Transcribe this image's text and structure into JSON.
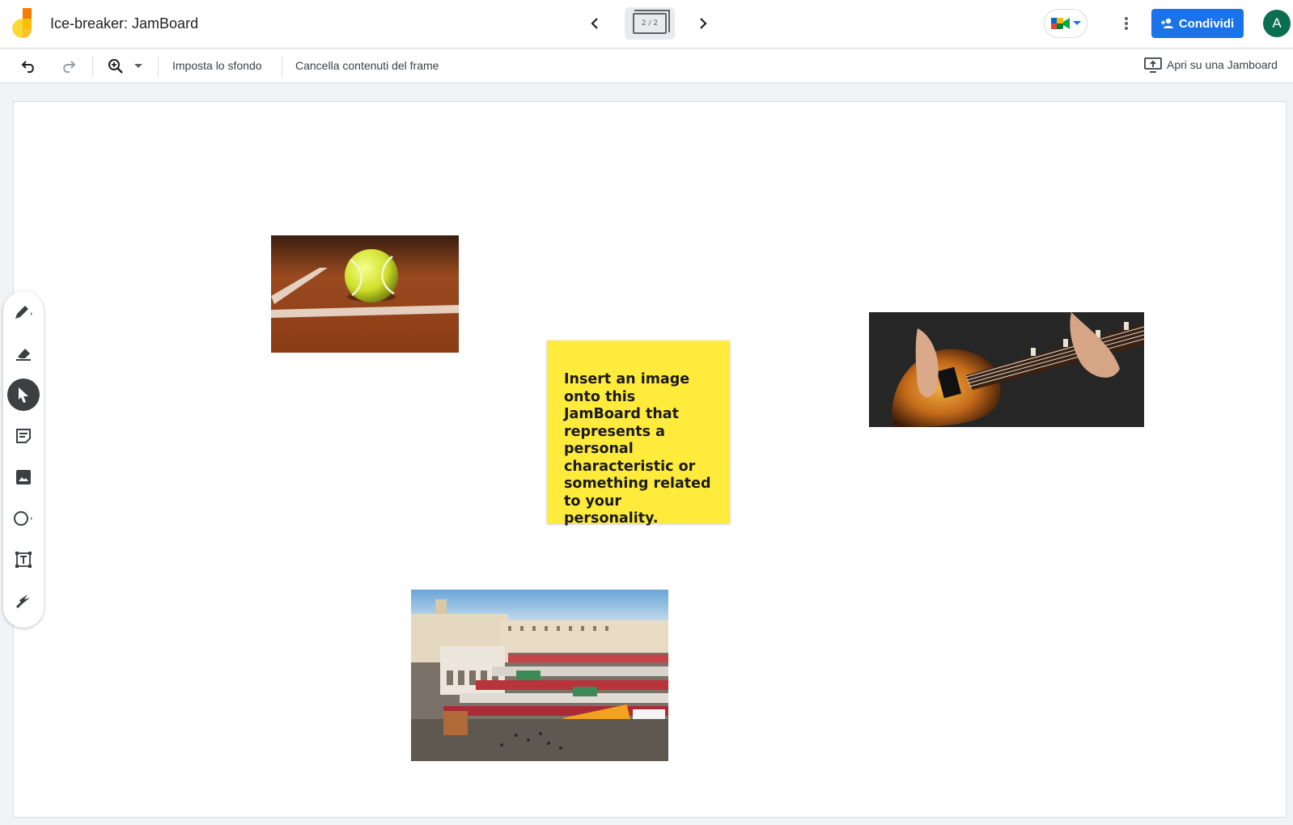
{
  "app": {
    "title": "Ice-breaker: JamBoard",
    "frame_counter": "2 / 2"
  },
  "header": {
    "share_label": "Condividi",
    "avatar_initial": "A"
  },
  "toolbar": {
    "set_background_label": "Imposta lo sfondo",
    "clear_frame_label": "Cancella contenuti del frame",
    "open_on_jamboard_label": "Apri su una Jamboard"
  },
  "board": {
    "sticky_note": {
      "text": "Insert an image onto this JamBoard that represents a personal characteristic or something related to your personality.",
      "color": "#ffeb3b"
    },
    "images": [
      "tennis ball on clay court",
      "person playing electric guitar",
      "aerial view of city market square"
    ]
  },
  "tools": [
    "pen-icon",
    "eraser-icon",
    "select-icon",
    "sticky-note-icon",
    "image-icon",
    "circle-icon",
    "text-box-icon",
    "laser-icon"
  ],
  "colors": {
    "accent": "#1a73e8",
    "sticky": "#ffeb3b",
    "avatar": "#0b6e4f"
  }
}
